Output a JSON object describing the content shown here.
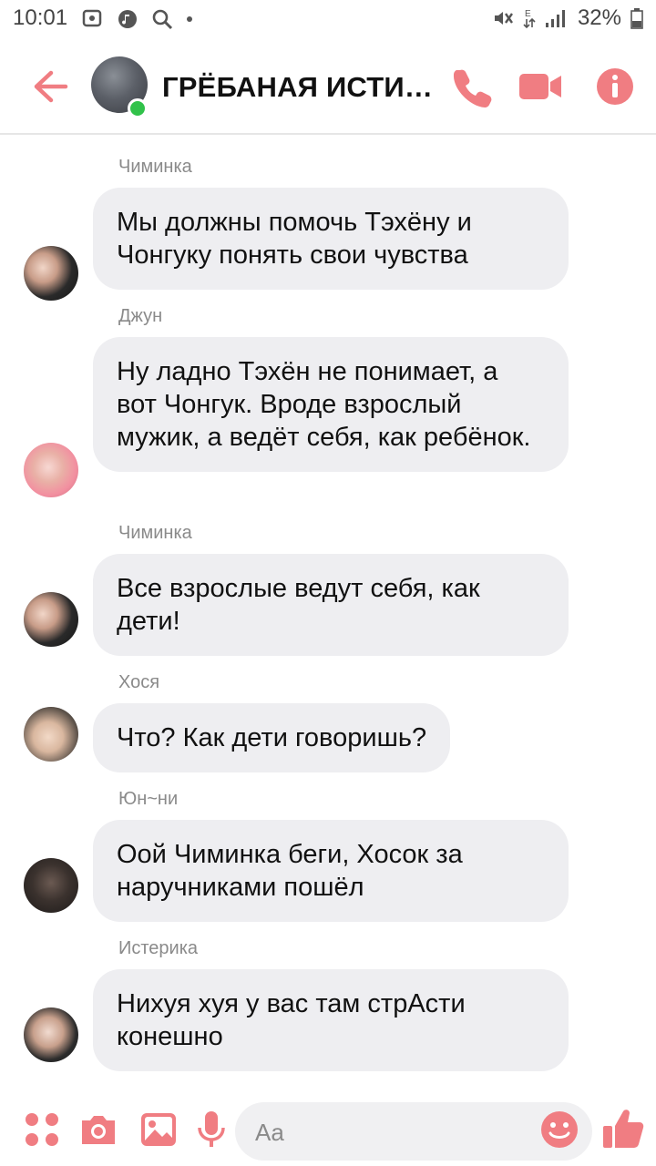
{
  "status_bar": {
    "time": "10:01",
    "battery": "32%"
  },
  "colors": {
    "accent": "#f07d82",
    "bubble": "#eeeef1",
    "online": "#31c24a"
  },
  "header": {
    "title": "ГРЁБАНАЯ ИСТИН…",
    "icons": [
      "back-arrow-icon",
      "phone-icon",
      "video-camera-icon",
      "info-icon"
    ]
  },
  "messages": [
    {
      "sender": "Чиминка",
      "text": "Мы должны помочь Тэхёну и Чонгуку понять свои чувства"
    },
    {
      "sender": "Джун",
      "text": "Ну ладно Тэхён не понимает, а вот Чонгук. Вроде взрослый мужик, а ведёт себя, как ребёнок."
    },
    {
      "sender": "Чиминка",
      "text": "Все взрослые ведут себя, как дети!"
    },
    {
      "sender": "Хося",
      "text": "Что? Как дети говоришь?"
    },
    {
      "sender": "Юн~ни",
      "text": "Оой Чиминка беги, Хосок за наручниками пошёл"
    },
    {
      "sender": "Истерика",
      "text": "Нихуя хуя у вас там стрАсти конешно"
    }
  ],
  "composer": {
    "placeholder": "Aa",
    "icons": [
      "apps-icon",
      "camera-icon",
      "image-icon",
      "microphone-icon",
      "emoji-icon",
      "thumbs-up-icon"
    ]
  }
}
